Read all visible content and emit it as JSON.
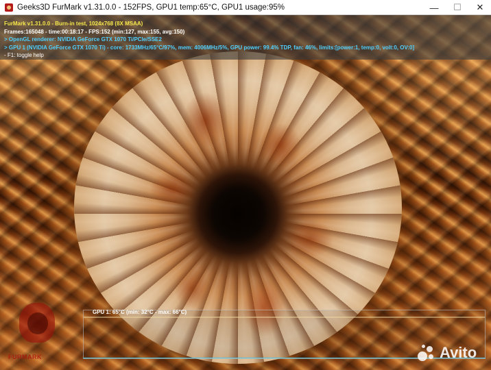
{
  "window": {
    "title": "Geeks3D FurMark v1.31.0.0 - 152FPS, GPU1 temp:65°C, GPU1 usage:95%",
    "controls": {
      "minimize": "—",
      "maximize": "☐",
      "close": "✕"
    }
  },
  "hud": {
    "line1": "FurMark v1.31.0.0 - Burn-in test, 1024x768 (8X MSAA)",
    "line2": "Frames:165048 - time:00:18:17 - FPS:152 (min:127, max:155, avg:150)",
    "line3": "> OpenGL renderer: NVIDIA GeForce GTX 1070 Ti/PCIe/SSE2",
    "line4": "> GPU 1 (NVIDIA GeForce GTX 1070 Ti) - core: 1733MHz/65°C/97%, mem: 4006MHz/5%, GPU power: 99.4% TDP, fan: 46%, limits:[power:1, temp:0, volt:0, OV:0]",
    "line5": "- F1: toggle help",
    "colors": {
      "title": "#f7e84a",
      "stats": "#ffffff",
      "gpu": "#4fd0ff"
    }
  },
  "graph": {
    "label": "GPU 1: 65°C (min: 32°C - max: 66°C)",
    "current_temp_c": 65,
    "min_temp_c": 32,
    "max_temp_c": 66,
    "line_color": "#f0d8a0",
    "baseline_color": "#4fc9e8"
  },
  "watermarks": {
    "left_text": "FURMARK",
    "avito_text": "Avito"
  }
}
